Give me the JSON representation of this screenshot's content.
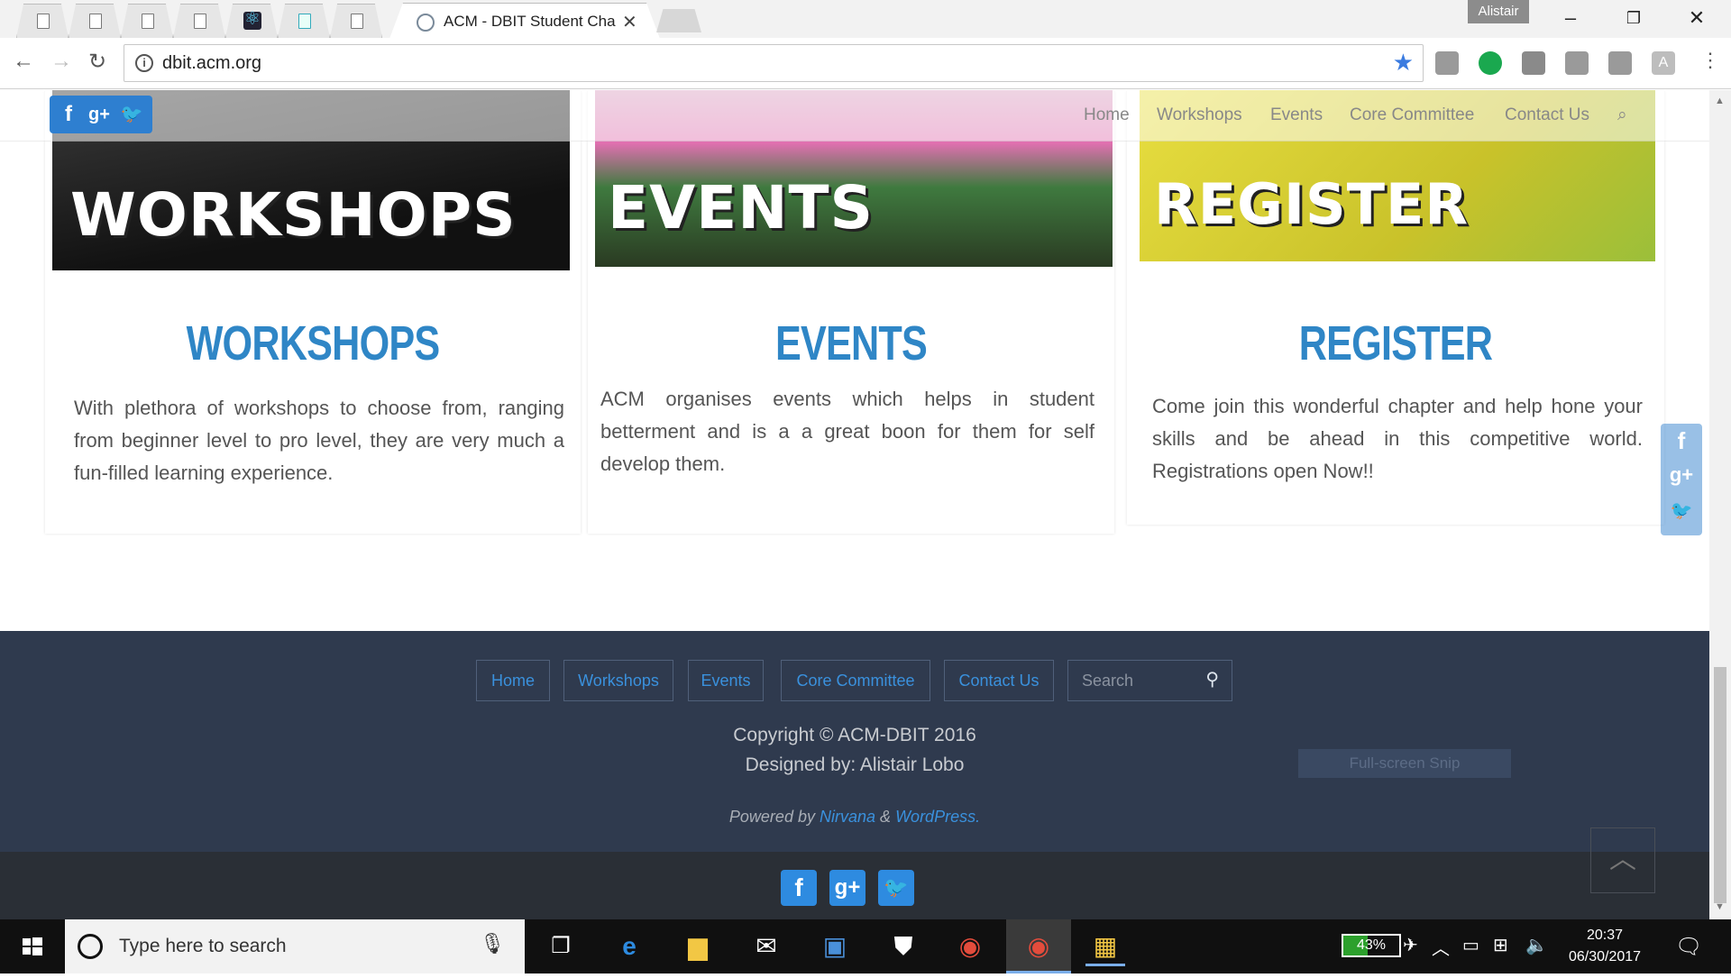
{
  "browser": {
    "active_tab_title": "ACM - DBIT Student Cha",
    "profile_name": "Alistair",
    "url": "dbit.acm.org"
  },
  "site": {
    "header_nav": [
      "Home",
      "Workshops",
      "Events",
      "Core Committee",
      "Contact Us"
    ],
    "cards": [
      {
        "image_text": "WORKSHOPS",
        "title": "WORKSHOPS",
        "text": "With plethora of workshops to choose from, ranging from beginner level to pro level, they are very much a fun-filled learning experience."
      },
      {
        "image_text": "EVENTS",
        "title": "EVENTS",
        "text": "ACM organises events which helps in student betterment and is a a great boon for them for self develop them."
      },
      {
        "image_text": "REGISTER",
        "title": "REGISTER",
        "text": "Come join this wonderful chapter and help hone your skills and be ahead in this competitive world. Registrations open Now!!"
      }
    ],
    "footer": {
      "nav": [
        "Home",
        "Workshops",
        "Events",
        "Core Committee",
        "Contact Us"
      ],
      "search_placeholder": "Search",
      "copyright": "Copyright © ACM-DBIT 2016",
      "designed_by": "Designed by: Alistair Lobo",
      "powered_prefix": "Powered by",
      "powered_nirvana": "Nirvana",
      "powered_amp": "&",
      "powered_wordpress": "WordPress.",
      "snip_label": "Full-screen Snip"
    }
  },
  "taskbar": {
    "search_placeholder": "Type here to search",
    "battery_percent": "43%",
    "battery_level": 0.43,
    "time": "20:37",
    "date": "06/30/2017"
  },
  "colors": {
    "accent_blue": "#2f86c6",
    "footer_bg": "#2f3a4e",
    "link_blue": "#3a91dd"
  }
}
